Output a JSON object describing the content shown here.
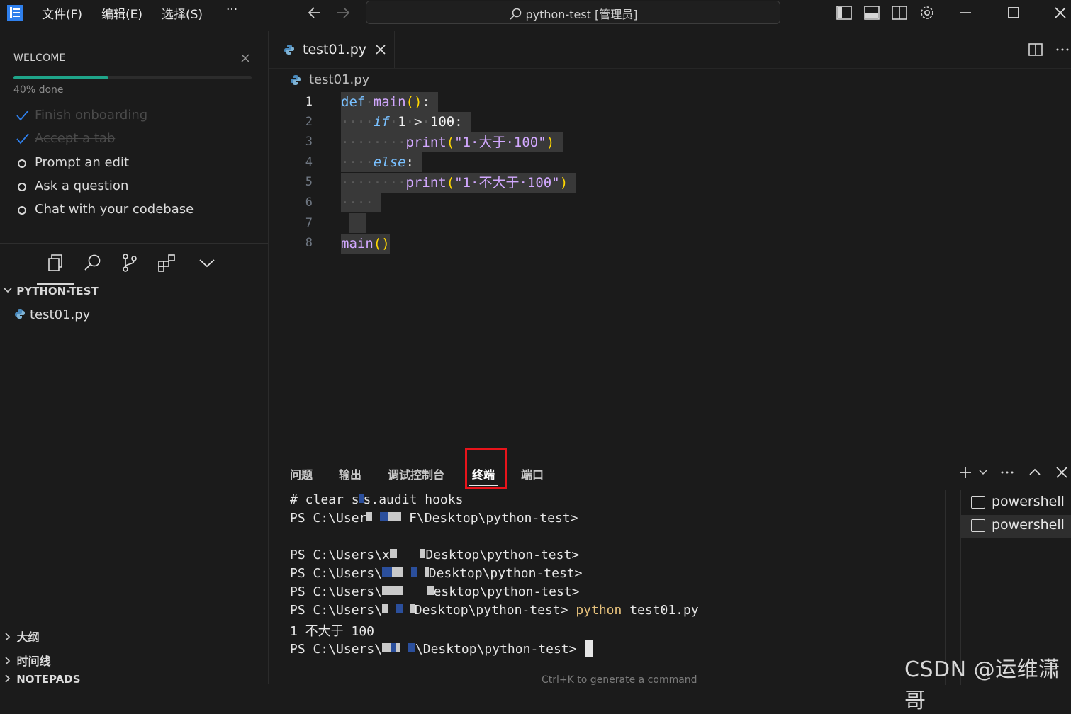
{
  "titlebar": {
    "menu": [
      "文件(F)",
      "编辑(E)",
      "选择(S)",
      "···"
    ],
    "command_center": "python-test [管理员]"
  },
  "welcome": {
    "title": "WELCOME",
    "progress_fraction": 0.4,
    "progress_text": "40% done",
    "steps": [
      {
        "label": "Finish onboarding",
        "done": true
      },
      {
        "label": "Accept a tab",
        "done": true
      },
      {
        "label": "Prompt an edit",
        "done": false
      },
      {
        "label": "Ask a question",
        "done": false
      },
      {
        "label": "Chat with your codebase",
        "done": false
      }
    ]
  },
  "explorer": {
    "folder": "PYTHON-TEST",
    "file": "test01.py",
    "sections": [
      "大纲",
      "时间线",
      "NOTEPADS"
    ]
  },
  "editor": {
    "tab": "test01.py",
    "breadcrumb": "test01.py",
    "line_numbers": [
      "1",
      "2",
      "3",
      "4",
      "5",
      "6",
      "7",
      "8"
    ],
    "code": {
      "l1_kw": "def",
      "l1_fn": "main",
      "l1_paren": "()",
      "l1_colon": ":",
      "l2_kw": "if",
      "l2_n1": "1",
      "l2_op": ">",
      "l2_n2": "100",
      "l2_colon": ":",
      "l3_fn": "print",
      "l3_str": "\"1·大于·100\"",
      "l4_kw": "else",
      "l4_colon": ":",
      "l5_fn": "print",
      "l5_str": "\"1·不大于·100\"",
      "l8_fn": "main",
      "l8_paren": "()"
    }
  },
  "panel": {
    "tabs": [
      "问题",
      "输出",
      "调试控制台",
      "终端",
      "端口"
    ],
    "active_tab": "终端",
    "terminal_lines": {
      "l1a": "# clear s",
      "l1b": "s.audit hooks",
      "l2a": "PS C:\\User",
      "l2b": "F\\Desktop\\python-test>",
      "l3a": "PS C:\\Users\\x",
      "l3b": "Desktop\\python-test>",
      "l4a": "PS C:\\Users\\",
      "l4b": "Desktop\\python-test>",
      "l5a": "PS C:\\Users\\",
      "l5b": "esktop\\python-test>",
      "l6a": "PS C:\\Users\\",
      "l6b": "Desktop\\python-test>",
      "l6cmd": "python",
      "l6arg": "test01.py",
      "l7": "1 不大于 100",
      "l8a": "PS C:\\Users\\",
      "l8b": "\\Desktop\\python-test>"
    },
    "terminals": [
      "powershell",
      "powershell"
    ],
    "hint": "Ctrl+K to generate a command"
  },
  "watermark": "CSDN @运维潇哥",
  "colors": {
    "accent_progress": "#1fa58a",
    "highlight_box": "#e8141b"
  }
}
